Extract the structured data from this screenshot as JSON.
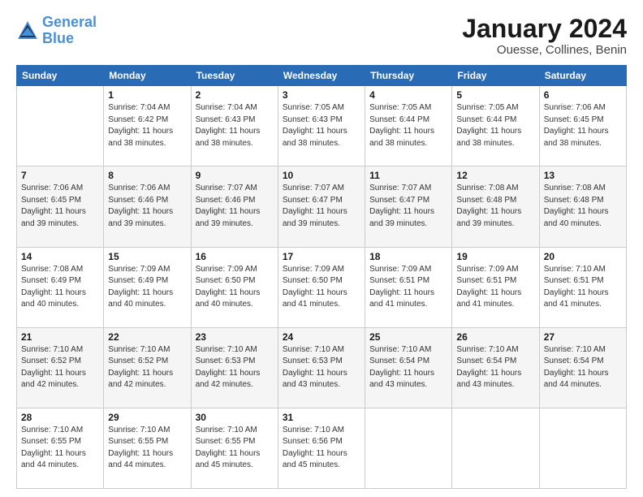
{
  "header": {
    "logo_line1": "General",
    "logo_line2": "Blue",
    "title": "January 2024",
    "subtitle": "Ouesse, Collines, Benin"
  },
  "weekdays": [
    "Sunday",
    "Monday",
    "Tuesday",
    "Wednesday",
    "Thursday",
    "Friday",
    "Saturday"
  ],
  "weeks": [
    [
      {
        "day": "",
        "sunrise": "",
        "sunset": "",
        "daylight": ""
      },
      {
        "day": "1",
        "sunrise": "Sunrise: 7:04 AM",
        "sunset": "Sunset: 6:42 PM",
        "daylight": "Daylight: 11 hours and 38 minutes."
      },
      {
        "day": "2",
        "sunrise": "Sunrise: 7:04 AM",
        "sunset": "Sunset: 6:43 PM",
        "daylight": "Daylight: 11 hours and 38 minutes."
      },
      {
        "day": "3",
        "sunrise": "Sunrise: 7:05 AM",
        "sunset": "Sunset: 6:43 PM",
        "daylight": "Daylight: 11 hours and 38 minutes."
      },
      {
        "day": "4",
        "sunrise": "Sunrise: 7:05 AM",
        "sunset": "Sunset: 6:44 PM",
        "daylight": "Daylight: 11 hours and 38 minutes."
      },
      {
        "day": "5",
        "sunrise": "Sunrise: 7:05 AM",
        "sunset": "Sunset: 6:44 PM",
        "daylight": "Daylight: 11 hours and 38 minutes."
      },
      {
        "day": "6",
        "sunrise": "Sunrise: 7:06 AM",
        "sunset": "Sunset: 6:45 PM",
        "daylight": "Daylight: 11 hours and 38 minutes."
      }
    ],
    [
      {
        "day": "7",
        "sunrise": "Sunrise: 7:06 AM",
        "sunset": "Sunset: 6:45 PM",
        "daylight": "Daylight: 11 hours and 39 minutes."
      },
      {
        "day": "8",
        "sunrise": "Sunrise: 7:06 AM",
        "sunset": "Sunset: 6:46 PM",
        "daylight": "Daylight: 11 hours and 39 minutes."
      },
      {
        "day": "9",
        "sunrise": "Sunrise: 7:07 AM",
        "sunset": "Sunset: 6:46 PM",
        "daylight": "Daylight: 11 hours and 39 minutes."
      },
      {
        "day": "10",
        "sunrise": "Sunrise: 7:07 AM",
        "sunset": "Sunset: 6:47 PM",
        "daylight": "Daylight: 11 hours and 39 minutes."
      },
      {
        "day": "11",
        "sunrise": "Sunrise: 7:07 AM",
        "sunset": "Sunset: 6:47 PM",
        "daylight": "Daylight: 11 hours and 39 minutes."
      },
      {
        "day": "12",
        "sunrise": "Sunrise: 7:08 AM",
        "sunset": "Sunset: 6:48 PM",
        "daylight": "Daylight: 11 hours and 39 minutes."
      },
      {
        "day": "13",
        "sunrise": "Sunrise: 7:08 AM",
        "sunset": "Sunset: 6:48 PM",
        "daylight": "Daylight: 11 hours and 40 minutes."
      }
    ],
    [
      {
        "day": "14",
        "sunrise": "Sunrise: 7:08 AM",
        "sunset": "Sunset: 6:49 PM",
        "daylight": "Daylight: 11 hours and 40 minutes."
      },
      {
        "day": "15",
        "sunrise": "Sunrise: 7:09 AM",
        "sunset": "Sunset: 6:49 PM",
        "daylight": "Daylight: 11 hours and 40 minutes."
      },
      {
        "day": "16",
        "sunrise": "Sunrise: 7:09 AM",
        "sunset": "Sunset: 6:50 PM",
        "daylight": "Daylight: 11 hours and 40 minutes."
      },
      {
        "day": "17",
        "sunrise": "Sunrise: 7:09 AM",
        "sunset": "Sunset: 6:50 PM",
        "daylight": "Daylight: 11 hours and 41 minutes."
      },
      {
        "day": "18",
        "sunrise": "Sunrise: 7:09 AM",
        "sunset": "Sunset: 6:51 PM",
        "daylight": "Daylight: 11 hours and 41 minutes."
      },
      {
        "day": "19",
        "sunrise": "Sunrise: 7:09 AM",
        "sunset": "Sunset: 6:51 PM",
        "daylight": "Daylight: 11 hours and 41 minutes."
      },
      {
        "day": "20",
        "sunrise": "Sunrise: 7:10 AM",
        "sunset": "Sunset: 6:51 PM",
        "daylight": "Daylight: 11 hours and 41 minutes."
      }
    ],
    [
      {
        "day": "21",
        "sunrise": "Sunrise: 7:10 AM",
        "sunset": "Sunset: 6:52 PM",
        "daylight": "Daylight: 11 hours and 42 minutes."
      },
      {
        "day": "22",
        "sunrise": "Sunrise: 7:10 AM",
        "sunset": "Sunset: 6:52 PM",
        "daylight": "Daylight: 11 hours and 42 minutes."
      },
      {
        "day": "23",
        "sunrise": "Sunrise: 7:10 AM",
        "sunset": "Sunset: 6:53 PM",
        "daylight": "Daylight: 11 hours and 42 minutes."
      },
      {
        "day": "24",
        "sunrise": "Sunrise: 7:10 AM",
        "sunset": "Sunset: 6:53 PM",
        "daylight": "Daylight: 11 hours and 43 minutes."
      },
      {
        "day": "25",
        "sunrise": "Sunrise: 7:10 AM",
        "sunset": "Sunset: 6:54 PM",
        "daylight": "Daylight: 11 hours and 43 minutes."
      },
      {
        "day": "26",
        "sunrise": "Sunrise: 7:10 AM",
        "sunset": "Sunset: 6:54 PM",
        "daylight": "Daylight: 11 hours and 43 minutes."
      },
      {
        "day": "27",
        "sunrise": "Sunrise: 7:10 AM",
        "sunset": "Sunset: 6:54 PM",
        "daylight": "Daylight: 11 hours and 44 minutes."
      }
    ],
    [
      {
        "day": "28",
        "sunrise": "Sunrise: 7:10 AM",
        "sunset": "Sunset: 6:55 PM",
        "daylight": "Daylight: 11 hours and 44 minutes."
      },
      {
        "day": "29",
        "sunrise": "Sunrise: 7:10 AM",
        "sunset": "Sunset: 6:55 PM",
        "daylight": "Daylight: 11 hours and 44 minutes."
      },
      {
        "day": "30",
        "sunrise": "Sunrise: 7:10 AM",
        "sunset": "Sunset: 6:55 PM",
        "daylight": "Daylight: 11 hours and 45 minutes."
      },
      {
        "day": "31",
        "sunrise": "Sunrise: 7:10 AM",
        "sunset": "Sunset: 6:56 PM",
        "daylight": "Daylight: 11 hours and 45 minutes."
      },
      {
        "day": "",
        "sunrise": "",
        "sunset": "",
        "daylight": ""
      },
      {
        "day": "",
        "sunrise": "",
        "sunset": "",
        "daylight": ""
      },
      {
        "day": "",
        "sunrise": "",
        "sunset": "",
        "daylight": ""
      }
    ]
  ]
}
